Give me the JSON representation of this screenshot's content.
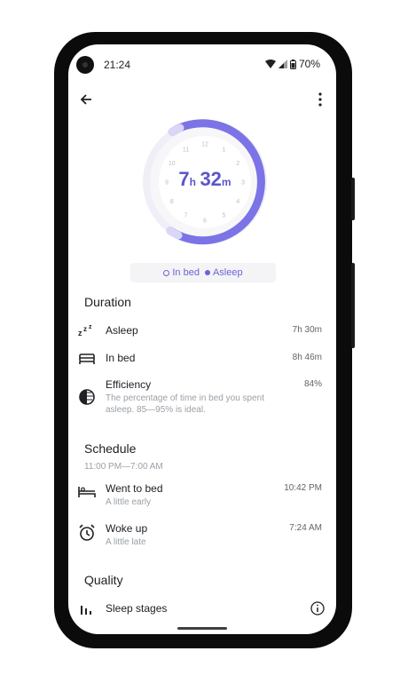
{
  "status": {
    "time": "21:24",
    "battery": "70%"
  },
  "sleep": {
    "hours": "7",
    "hours_unit": "h",
    "minutes": "32",
    "minutes_unit": "m",
    "dial_numbers": [
      "12",
      "1",
      "2",
      "3",
      "4",
      "5",
      "6",
      "7",
      "8",
      "9",
      "10",
      "11"
    ],
    "legend_in_bed": "In bed",
    "legend_asleep": "Asleep"
  },
  "duration": {
    "title": "Duration",
    "asleep_label": "Asleep",
    "asleep_value": "7h 30m",
    "inbed_label": "In bed",
    "inbed_value": "8h 46m",
    "efficiency_label": "Efficiency",
    "efficiency_value": "84%",
    "efficiency_desc": "The percentage of time in bed you spent asleep. 85—95% is ideal."
  },
  "schedule": {
    "title": "Schedule",
    "range": "11:00 PM—7:00 AM",
    "bed_label": "Went to bed",
    "bed_sub": "A little early",
    "bed_time": "10:42 PM",
    "woke_label": "Woke up",
    "woke_sub": "A little late",
    "woke_time": "7:24 AM"
  },
  "quality": {
    "title": "Quality",
    "stages_label": "Sleep stages"
  },
  "colors": {
    "accent": "#7b73e6",
    "accent_light": "#d9d6f7"
  },
  "icons": [
    "back-arrow-icon",
    "more-vert-icon",
    "zzz-icon",
    "bed-icon",
    "efficiency-icon",
    "bed-time-icon",
    "alarm-icon",
    "bar-chart-icon",
    "info-icon"
  ]
}
